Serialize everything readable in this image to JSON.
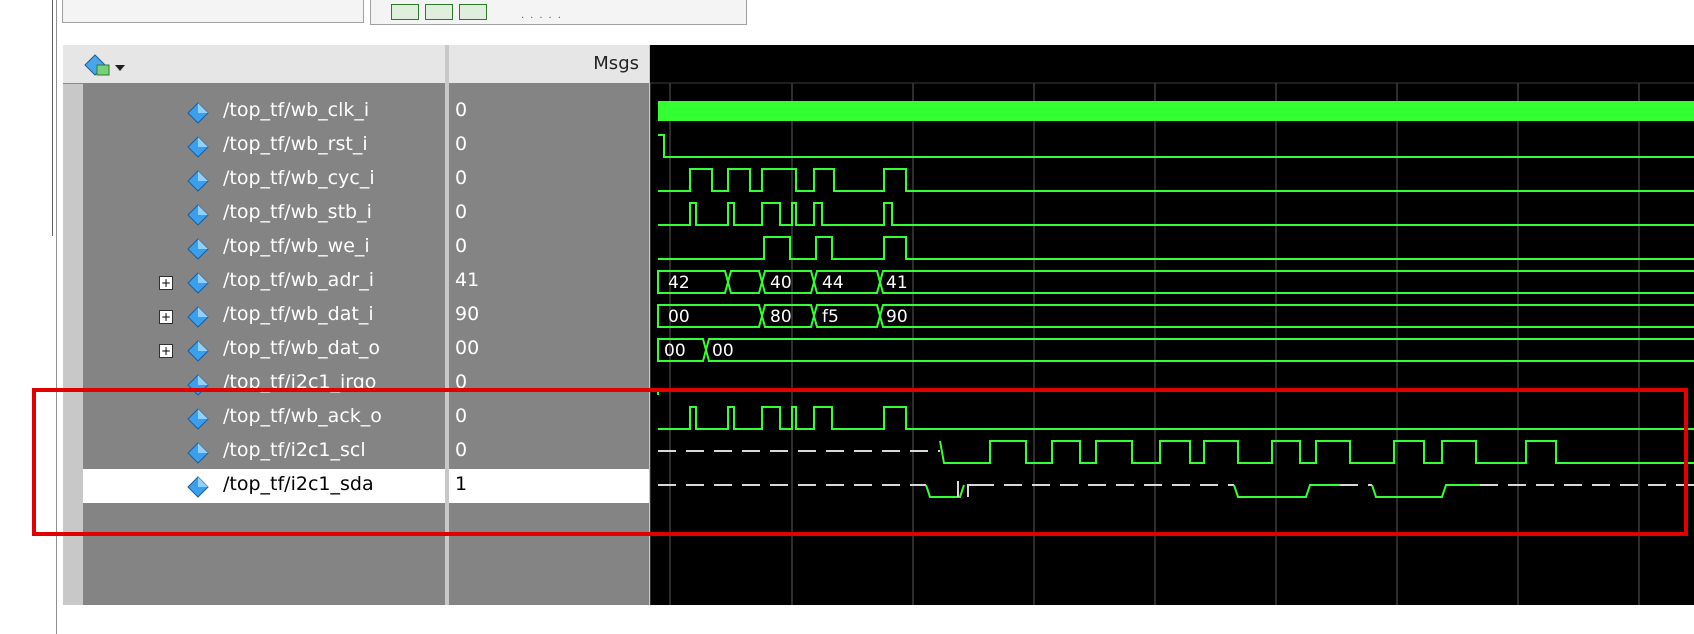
{
  "wave_window": {
    "msgs_header": "Msgs",
    "signals": [
      {
        "name": "/top_tf/wb_clk_i",
        "value": "0",
        "expandable": false
      },
      {
        "name": "/top_tf/wb_rst_i",
        "value": "0",
        "expandable": false
      },
      {
        "name": "/top_tf/wb_cyc_i",
        "value": "0",
        "expandable": false
      },
      {
        "name": "/top_tf/wb_stb_i",
        "value": "0",
        "expandable": false
      },
      {
        "name": "/top_tf/wb_we_i",
        "value": "0",
        "expandable": false
      },
      {
        "name": "/top_tf/wb_adr_i",
        "value": "41",
        "expandable": true
      },
      {
        "name": "/top_tf/wb_dat_i",
        "value": "90",
        "expandable": true
      },
      {
        "name": "/top_tf/wb_dat_o",
        "value": "00",
        "expandable": true
      },
      {
        "name": "/top_tf/i2c1_irqo",
        "value": "0",
        "expandable": false
      },
      {
        "name": "/top_tf/wb_ack_o",
        "value": "0",
        "expandable": false
      },
      {
        "name": "/top_tf/i2c1_scl",
        "value": "0",
        "expandable": false
      },
      {
        "name": "/top_tf/i2c1_sda",
        "value": "1",
        "expandable": false,
        "selected": true
      }
    ],
    "bus_labels": {
      "adr": [
        "42",
        "40",
        "44",
        "41"
      ],
      "dat_i": [
        "00",
        "80",
        "f5",
        "90"
      ],
      "dat_o": [
        "00",
        "00"
      ]
    }
  },
  "colors": {
    "wave": "#33ff33",
    "highz": "#d8d8d8",
    "grid": "#5a5a5a",
    "highlight": "#e00000",
    "panel": "#848484"
  }
}
